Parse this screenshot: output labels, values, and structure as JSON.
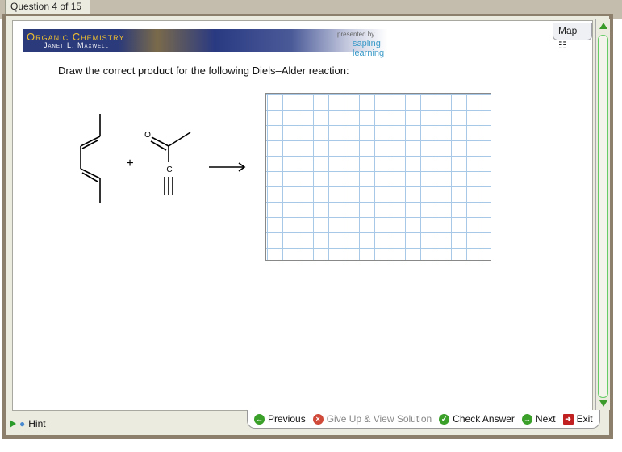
{
  "question_tab": "Question 4 of 15",
  "banner": {
    "title": "Organic Chemistry",
    "author": "Janet L. Maxwell",
    "presented_by": "presented by",
    "brand": "sapling learning"
  },
  "map_label": "Map",
  "question_text": "Draw the correct product for the following Diels–Alder reaction:",
  "molecule": {
    "oxygen": "O",
    "carbon": "C",
    "plus": "+"
  },
  "hint_label": "Hint",
  "buttons": {
    "previous": "Previous",
    "give_up": "Give Up & View Solution",
    "check": "Check Answer",
    "next": "Next",
    "exit": "Exit"
  },
  "colors": {
    "accent": "#3a9a2a",
    "banner": "#2b3a7a",
    "disabled": "#888888"
  }
}
